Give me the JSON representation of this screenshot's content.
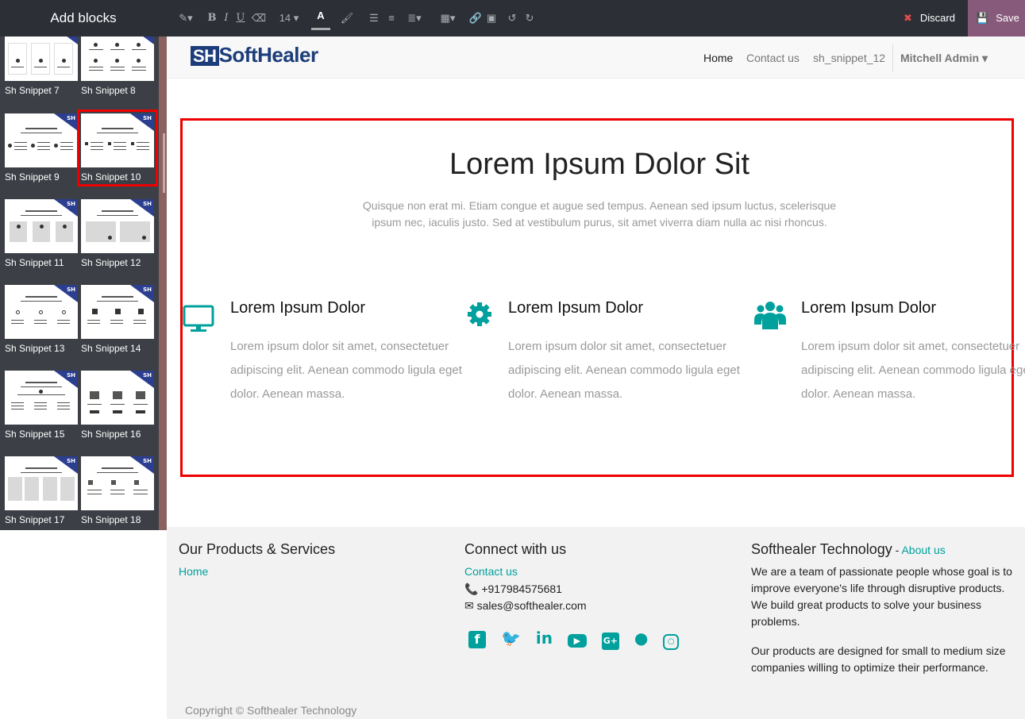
{
  "sidebar": {
    "title": "Add blocks",
    "snippets": [
      "Sh Snippet 7",
      "Sh Snippet 8",
      "Sh Snippet 9",
      "Sh Snippet 10",
      "Sh Snippet 11",
      "Sh Snippet 12",
      "Sh Snippet 13",
      "Sh Snippet 14",
      "Sh Snippet 15",
      "Sh Snippet 16",
      "Sh Snippet 17",
      "Sh Snippet 18"
    ],
    "thumb_logo": "SH"
  },
  "toolbar": {
    "font_size": "14",
    "discard_label": "Discard",
    "save_label": "Save",
    "font_color_label": "A"
  },
  "nav": {
    "brand": "SoftHealer",
    "items": [
      "Home",
      "Contact us",
      "sh_snippet_12"
    ],
    "user": "Mitchell Admin"
  },
  "snippet": {
    "title": "Lorem Ipsum Dolor Sit",
    "subtitle": "Quisque non erat mi. Etiam congue et augue sed tempus. Aenean sed ipsum luctus, scelerisque ipsum nec, iaculis justo. Sed at vestibulum purus, sit amet viverra diam nulla ac nisi rhoncus.",
    "columns": [
      {
        "icon": "desktop-icon",
        "heading": "Lorem Ipsum Dolor",
        "text": "Lorem ipsum dolor sit amet, consectetuer adipiscing elit. Aenean commodo ligula eget dolor. Aenean massa."
      },
      {
        "icon": "gear-icon",
        "heading": "Lorem Ipsum Dolor",
        "text": "Lorem ipsum dolor sit amet, consectetuer adipiscing elit. Aenean commodo ligula eget dolor. Aenean massa."
      },
      {
        "icon": "users-icon",
        "heading": "Lorem Ipsum Dolor",
        "text": "Lorem ipsum dolor sit amet, consectetuer adipiscing elit. Aenean commodo ligula eget dolor. Aenean massa."
      }
    ]
  },
  "footer": {
    "products_title": "Our Products & Services",
    "products_link": "Home",
    "connect_title": "Connect with us",
    "contact_link": "Contact us",
    "phone": "+917984575681",
    "email": "sales@softhealer.com",
    "company_title": "Softhealer Technology",
    "company_sep": " - ",
    "about_link": "About us",
    "about_p1": "We are a team of passionate people whose goal is to improve everyone's life through disruptive products. We build great products to solve your business problems.",
    "about_p2": "Our products are designed for small to medium size companies willing to optimize their performance.",
    "copyright": "Copyright © Softhealer Technology"
  },
  "colors": {
    "accent": "#00a09d",
    "save": "#875a7b",
    "selection": "#ee0000",
    "brand": "#1c3d7a"
  }
}
